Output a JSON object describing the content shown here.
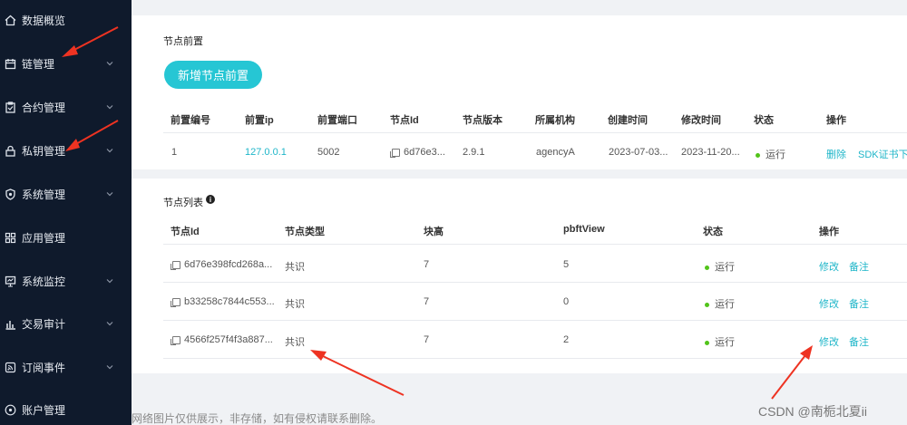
{
  "sidebar": {
    "items": [
      {
        "label": "数据概览",
        "icon": "home-icon",
        "has_chevron": false
      },
      {
        "label": "链管理",
        "icon": "calendar-icon",
        "has_chevron": true
      },
      {
        "label": "合约管理",
        "icon": "clipboard-icon",
        "has_chevron": true
      },
      {
        "label": "私钥管理",
        "icon": "lock-icon",
        "has_chevron": true
      },
      {
        "label": "系统管理",
        "icon": "shield-icon",
        "has_chevron": true
      },
      {
        "label": "应用管理",
        "icon": "grid-icon",
        "has_chevron": false
      },
      {
        "label": "系统监控",
        "icon": "monitor-icon",
        "has_chevron": true
      },
      {
        "label": "交易审计",
        "icon": "bar-chart-icon",
        "has_chevron": true
      },
      {
        "label": "订阅事件",
        "icon": "rss-icon",
        "has_chevron": true
      },
      {
        "label": "账户管理",
        "icon": "user-icon",
        "has_chevron": false
      }
    ]
  },
  "front_card": {
    "title": "节点前置",
    "add_button": "新增节点前置",
    "headers": [
      "前置编号",
      "前置ip",
      "前置端口",
      "节点Id",
      "节点版本",
      "所属机构",
      "创建时间",
      "修改时间",
      "状态",
      "操作"
    ],
    "rows": [
      {
        "id": "1",
        "ip": "127.0.0.1",
        "port": "5002",
        "node_id": "6d76e3...",
        "version": "2.9.1",
        "agency": "agencyA",
        "created": "2023-07-03...",
        "modified": "2023-11-20...",
        "status": "运行",
        "action_delete": "删除",
        "action_sdk": "SDK证书下载"
      }
    ]
  },
  "node_card": {
    "title": "节点列表",
    "headers": [
      "节点Id",
      "节点类型",
      "块高",
      "pbftView",
      "状态",
      "操作"
    ],
    "rows": [
      {
        "node_id": "6d76e398fcd268a...",
        "type": "共识",
        "height": "7",
        "view": "5",
        "status": "运行",
        "edit": "修改",
        "note": "备注"
      },
      {
        "node_id": "b33258c7844c553...",
        "type": "共识",
        "height": "7",
        "view": "0",
        "status": "运行",
        "edit": "修改",
        "note": "备注"
      },
      {
        "node_id": "4566f257f4f3a887...",
        "type": "共识",
        "height": "7",
        "view": "2",
        "status": "运行",
        "edit": "修改",
        "note": "备注"
      }
    ]
  },
  "watermark": "网络图片仅供展示，非存储，如有侵权请联系删除。",
  "credit": "CSDN @南栀北夏ii",
  "colors": {
    "accent": "#26c6d4",
    "link": "#1fb6c9",
    "sidebar": "#0f1a2c",
    "status_ok": "#52c41a",
    "arrow": "#ee3322"
  }
}
